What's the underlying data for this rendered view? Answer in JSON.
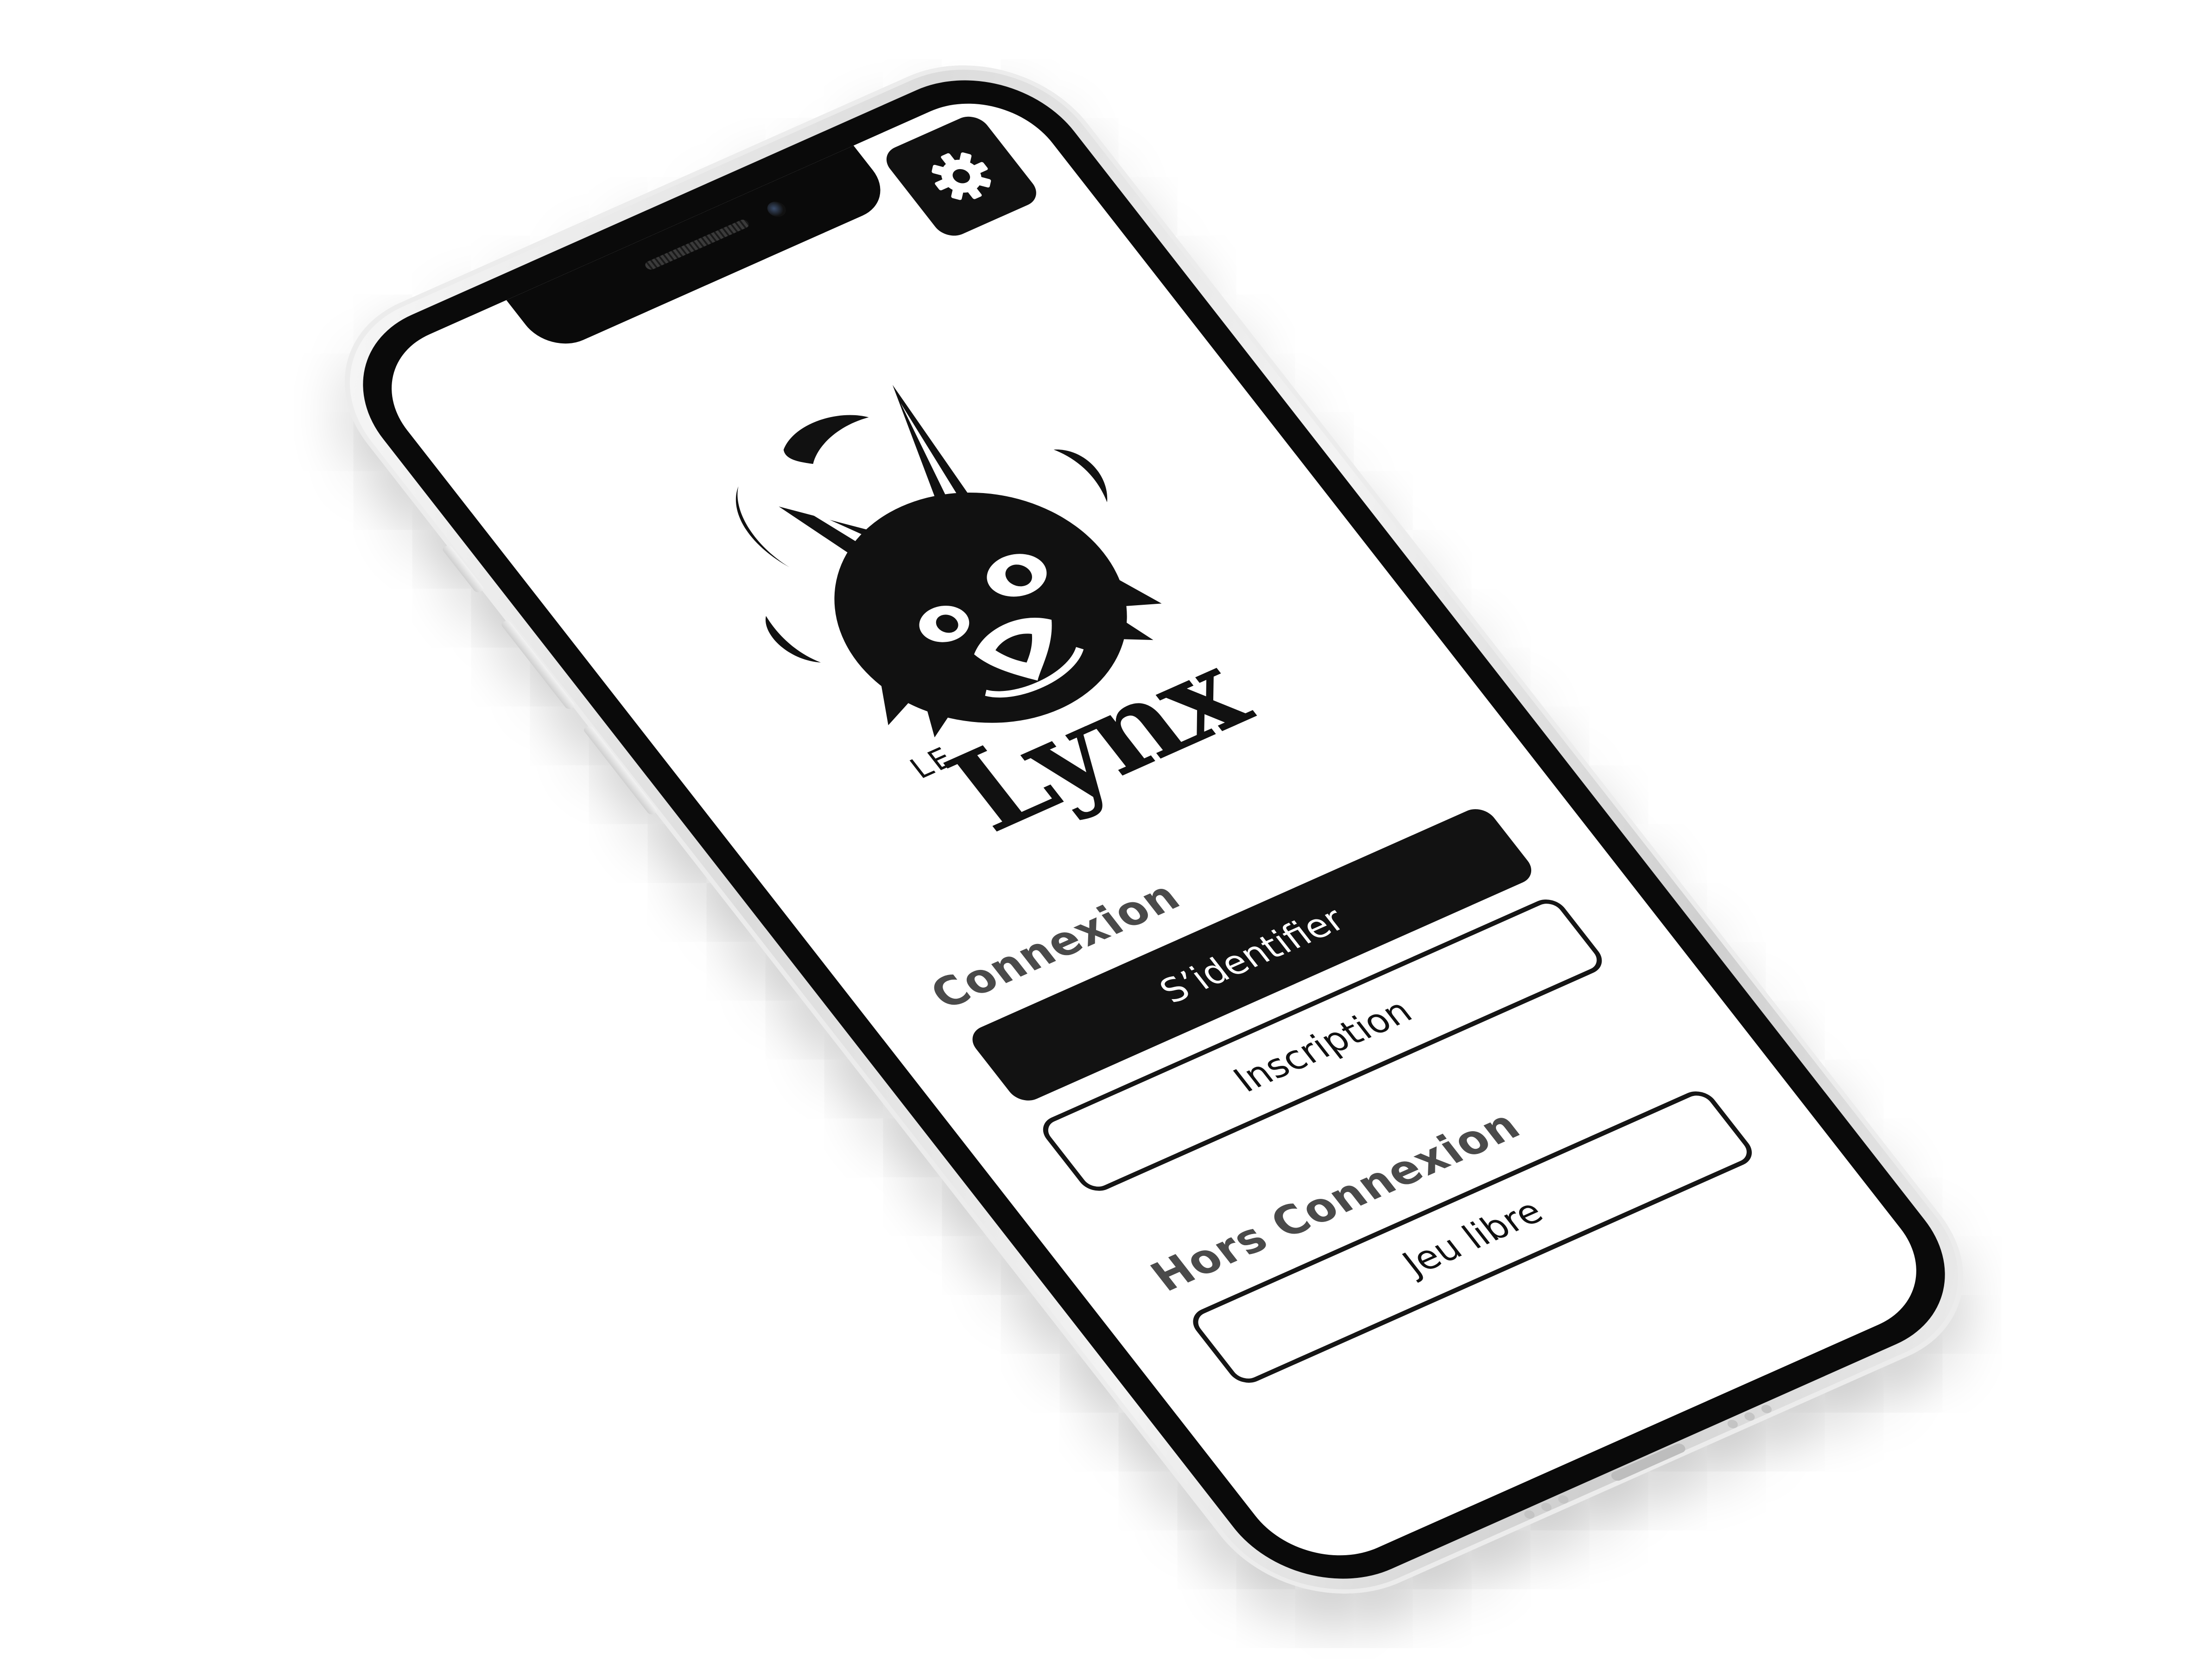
{
  "app": {
    "logo_prefix": "LE",
    "logo_name": "Lynx"
  },
  "online": {
    "title": "Connexion",
    "login_label": "S’identifier",
    "signup_label": "Inscription"
  },
  "offline": {
    "title": "Hors Connexion",
    "free_play_label": "Jeu libre"
  },
  "icons": {
    "settings": "gear-icon",
    "logo": "lynx-head-logo"
  },
  "colors": {
    "ink": "#121212",
    "screen": "#ffffff",
    "title_gray": "#4a4a4a",
    "frame_silver": "#e6e6e6"
  }
}
